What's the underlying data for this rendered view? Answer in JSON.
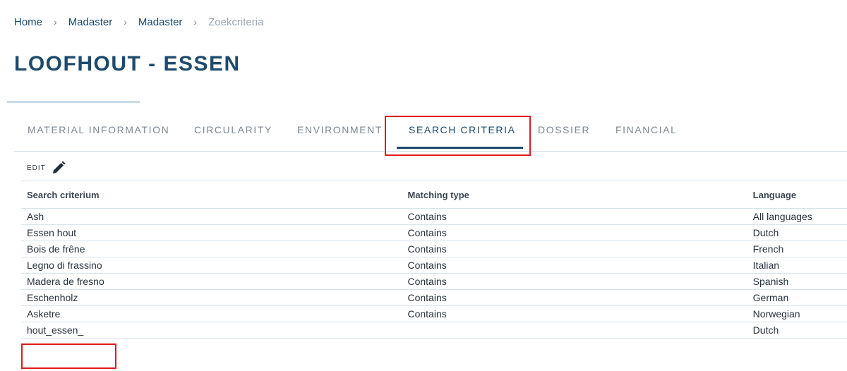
{
  "breadcrumb": {
    "items": [
      "Home",
      "Madaster",
      "Madaster"
    ],
    "current": "Zoekcriteria",
    "separator": "›"
  },
  "page": {
    "title": "LOOFHOUT - ESSEN"
  },
  "tabs": [
    {
      "label": "MATERIAL INFORMATION",
      "active": false
    },
    {
      "label": "CIRCULARITY",
      "active": false
    },
    {
      "label": "ENVIRONMENT",
      "active": false
    },
    {
      "label": "SEARCH CRITERIA",
      "active": true
    },
    {
      "label": "DOSSIER",
      "active": false
    },
    {
      "label": "FINANCIAL",
      "active": false
    }
  ],
  "toolbar": {
    "edit_label": "EDIT",
    "edit_icon": "pencil-icon"
  },
  "table": {
    "headers": [
      "Search criterium",
      "Matching type",
      "Language"
    ],
    "rows": [
      [
        "Ash",
        "Contains",
        "All languages"
      ],
      [
        "Essen hout",
        "Contains",
        "Dutch"
      ],
      [
        "Bois de frêne",
        "Contains",
        "French"
      ],
      [
        "Legno di frassino",
        "Contains",
        "Italian"
      ],
      [
        "Madera de fresno",
        "Contains",
        "Spanish"
      ],
      [
        "Eschenholz",
        "Contains",
        "German"
      ],
      [
        "Asketre",
        "Contains",
        "Norwegian"
      ],
      [
        "hout_essen_",
        "",
        "Dutch"
      ]
    ]
  },
  "colors": {
    "accent": "#1e4a6c",
    "highlight": "#e01b1b",
    "divider": "#d6e4ec"
  }
}
